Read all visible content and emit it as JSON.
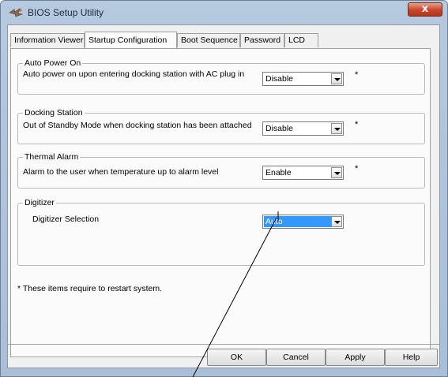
{
  "window": {
    "title": "BIOS Setup Utility",
    "close_label": "x"
  },
  "tabs": [
    {
      "label": "Information Viewer"
    },
    {
      "label": "Startup Configuration"
    },
    {
      "label": "Boot Sequence"
    },
    {
      "label": "Password"
    },
    {
      "label": "LCD"
    }
  ],
  "active_tab": "Startup Configuration",
  "groups": {
    "auto_power_on": {
      "title": "Auto Power On",
      "description": "Auto power on upon entering docking station with AC plug in",
      "value": "Disable",
      "asterisk": "*"
    },
    "docking_station": {
      "title": "Docking Station",
      "description": "Out of Standby Mode when docking station has been attached",
      "value": "Disable",
      "asterisk": "*"
    },
    "thermal_alarm": {
      "title": "Thermal Alarm",
      "description": "Alarm to the user when temperature up to alarm level",
      "value": "Enable",
      "asterisk": "*"
    },
    "digitizer": {
      "title": "Digitizer",
      "description": "Digitizer Selection",
      "value": "Auto"
    }
  },
  "note": "* These items require to restart system.",
  "buttons": {
    "ok": "OK",
    "cancel": "Cancel",
    "apply": "Apply",
    "help": "Help"
  },
  "colors": {
    "selection": "#3399ff",
    "close_button": "#c9442b",
    "frame": "#b5c9df"
  }
}
